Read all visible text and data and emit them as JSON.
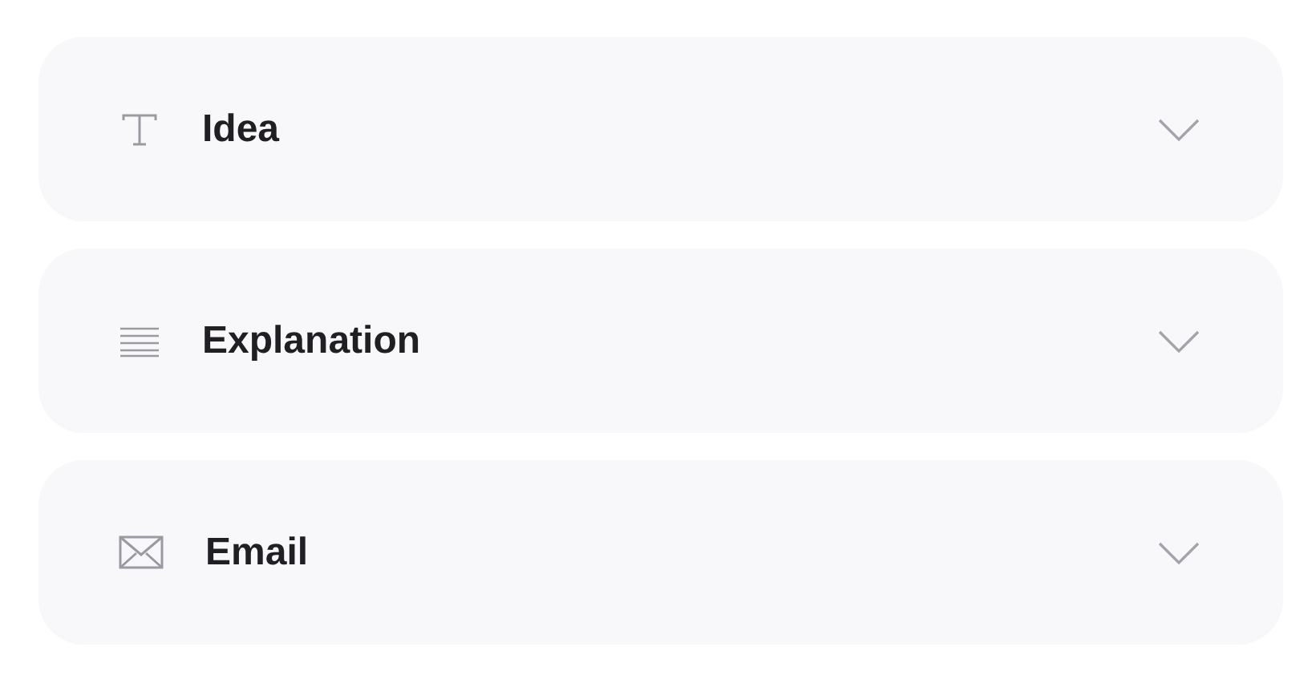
{
  "sections": [
    {
      "kind": "text",
      "label": "Idea",
      "expanded": false
    },
    {
      "kind": "paragraph",
      "label": "Explanation",
      "expanded": false
    },
    {
      "kind": "email",
      "label": "Email",
      "expanded": false
    }
  ]
}
